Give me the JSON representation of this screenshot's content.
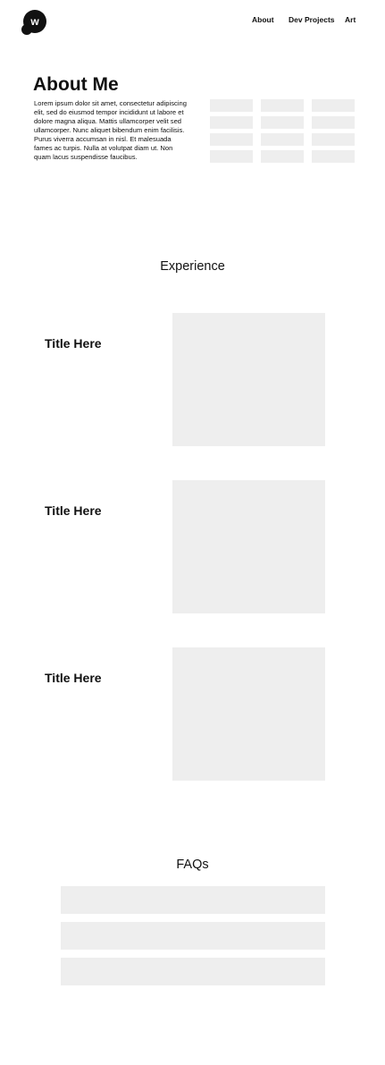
{
  "header": {
    "logo_letter": "w",
    "nav": [
      "About",
      "Dev Projects",
      "Art"
    ]
  },
  "about": {
    "title": "About Me",
    "body": "Lorem ipsum dolor sit amet, consectetur adipiscing elit, sed do eiusmod tempor incididunt ut labore et dolore magna aliqua. Mattis ullamcorper velit sed ullamcorper. Nunc aliquet bibendum enim facilisis. Purus viverra accumsan in nisl. Et malesuada fames ac turpis. Nulla at volutpat diam ut. Non quam lacus suspendisse faucibus."
  },
  "experience": {
    "heading": "Experience",
    "items": [
      {
        "title": "Title Here"
      },
      {
        "title": "Title Here"
      },
      {
        "title": "Title Here"
      }
    ]
  },
  "faqs": {
    "heading": "FAQs"
  },
  "colors": {
    "placeholder": "#eeeeee",
    "text": "#111111",
    "background": "#ffffff"
  }
}
